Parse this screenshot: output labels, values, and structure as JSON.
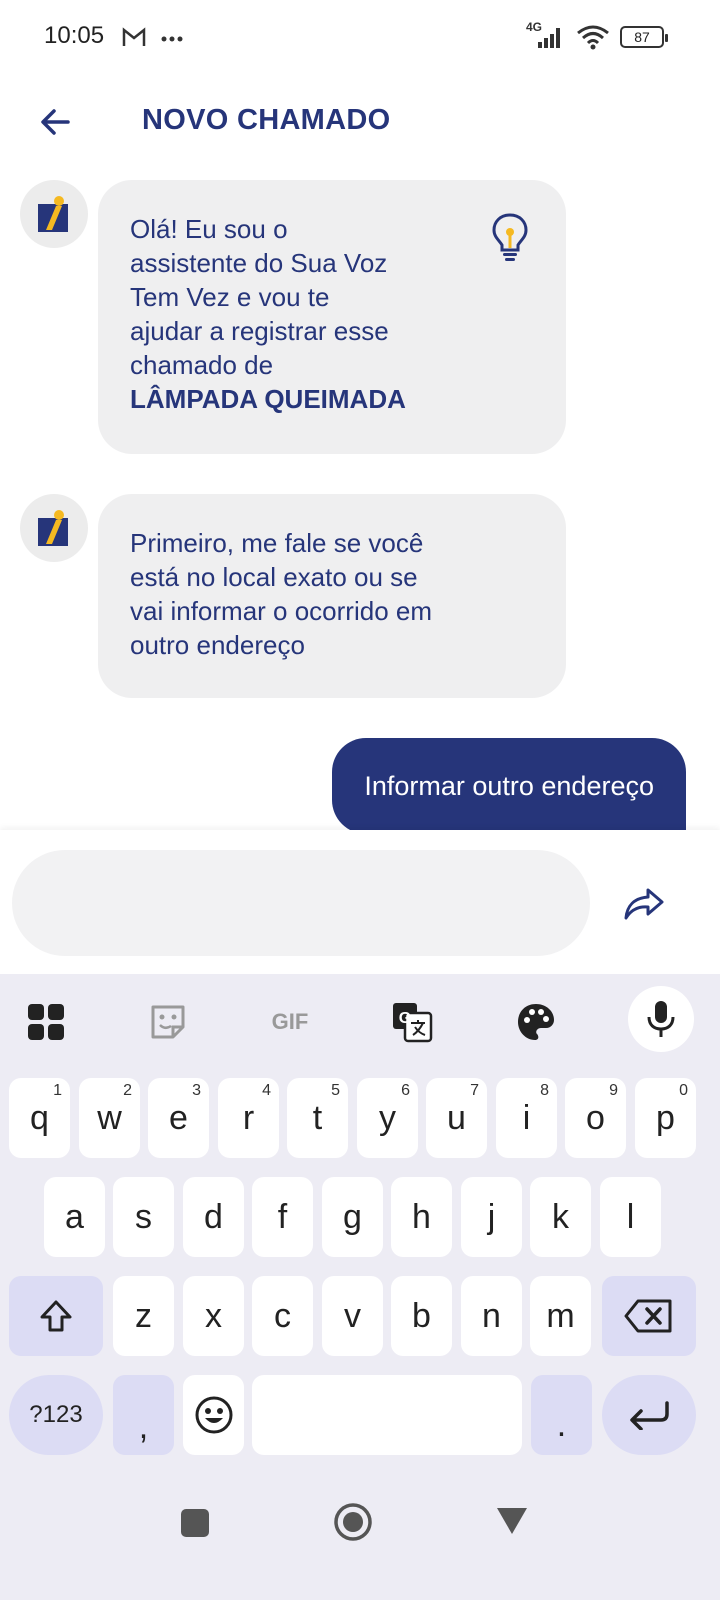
{
  "status_bar": {
    "time": "10:05",
    "network": "4G",
    "battery": "87"
  },
  "header": {
    "title": "NOVO CHAMADO"
  },
  "messages": [
    {
      "lines": [
        "Olá! Eu sou o",
        "assistente do Sua Voz",
        "Tem Vez e vou te",
        "ajudar a registrar esse",
        "chamado de"
      ],
      "bold": "LÂMPADA QUEIMADA"
    },
    {
      "lines": [
        "Primeiro, me fale se você",
        "está no local exato ou se",
        "vai informar o ocorrido em",
        "outro endereço"
      ]
    }
  ],
  "user_reply": "Informar outro endereço",
  "composer": {
    "value": "",
    "placeholder": ""
  },
  "keyboard": {
    "toolbar": [
      "apps-icon",
      "sticker-icon",
      "GIF",
      "translate-icon",
      "palette-icon",
      "mic-icon"
    ],
    "row1": [
      {
        "k": "q",
        "h": "1"
      },
      {
        "k": "w",
        "h": "2"
      },
      {
        "k": "e",
        "h": "3"
      },
      {
        "k": "r",
        "h": "4"
      },
      {
        "k": "t",
        "h": "5"
      },
      {
        "k": "y",
        "h": "6"
      },
      {
        "k": "u",
        "h": "7"
      },
      {
        "k": "i",
        "h": "8"
      },
      {
        "k": "o",
        "h": "9"
      },
      {
        "k": "p",
        "h": "0"
      }
    ],
    "row2": [
      "a",
      "s",
      "d",
      "f",
      "g",
      "h",
      "j",
      "k",
      "l"
    ],
    "row3": [
      "z",
      "x",
      "c",
      "v",
      "b",
      "n",
      "m"
    ],
    "symbols_label": "?123",
    "comma": ",",
    "period": "."
  },
  "colors": {
    "brand": "#26357a",
    "bubble": "#efeff0",
    "keyboard_bg": "#edecf4",
    "special_key": "#dcdcf4"
  }
}
